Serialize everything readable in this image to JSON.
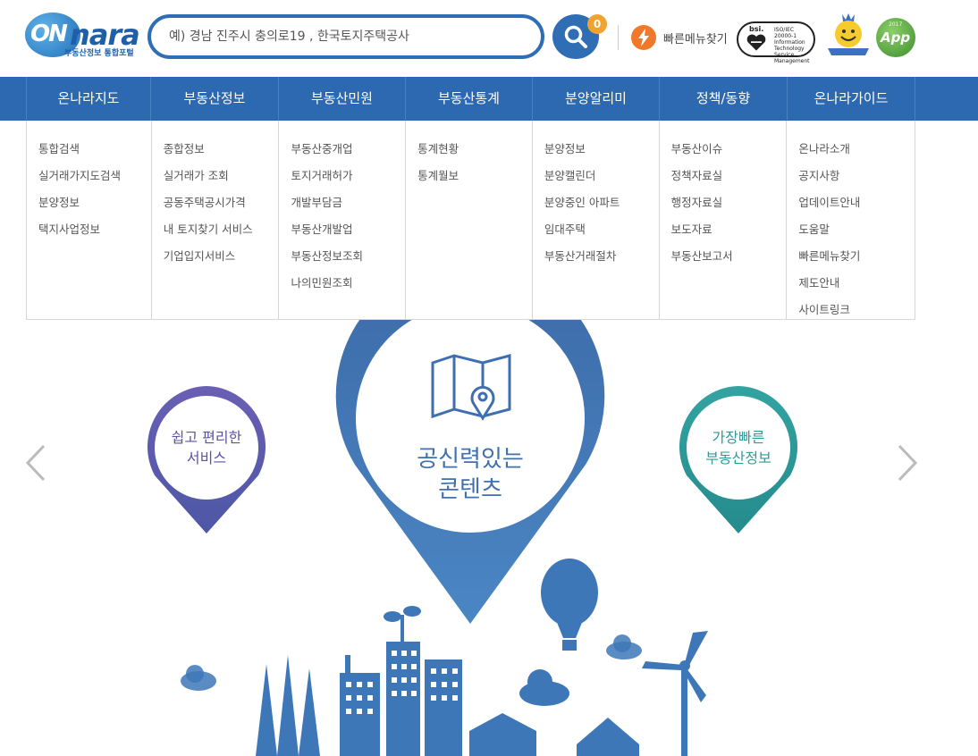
{
  "logo": {
    "on": "ON",
    "nara": "nara",
    "tagline": "부동산정보 통합포털"
  },
  "search": {
    "placeholder": "예) 경남 진주시 충의로19 , 한국토지주택공사",
    "badge_count": "0"
  },
  "quick_menu": {
    "label": "빠른메뉴찾기"
  },
  "certs": {
    "bsi": "bsi.",
    "iso_lines": [
      "ISO/IEC",
      "20000-1",
      "Information",
      "Technology Service",
      "Management"
    ],
    "app": "App",
    "app_year": "2017"
  },
  "nav": {
    "tabs": [
      "온나라지도",
      "부동산정보",
      "부동산민원",
      "부동산통계",
      "분양알리미",
      "정책/동향",
      "온나라가이드"
    ]
  },
  "mega_menu": [
    [
      "통합검색",
      "실거래가지도검색",
      "분양정보",
      "택지사업정보"
    ],
    [
      "종합정보",
      "실거래가 조회",
      "공동주택공시가격",
      "내 토지찾기 서비스",
      "기업입지서비스"
    ],
    [
      "부동산중개업",
      "토지거래허가",
      "개발부담금",
      "부동산개발업",
      "부동산정보조회",
      "나의민원조회"
    ],
    [
      "통계현황",
      "통계월보"
    ],
    [
      "분양정보",
      "분양캘린더",
      "분양중인 아파트",
      "임대주택",
      "부동산거래절차"
    ],
    [
      "부동산이슈",
      "정책자료실",
      "행정자료실",
      "보도자료",
      "부동산보고서"
    ],
    [
      "온나라소개",
      "공지사항",
      "업데이트안내",
      "도움말",
      "빠른메뉴찾기",
      "제도안내",
      "사이트링크"
    ]
  ],
  "hero": {
    "left_pin": [
      "쉽고 편리한",
      "서비스"
    ],
    "center_pin": [
      "공신력있는",
      "콘텐츠"
    ],
    "right_pin": [
      "가장빠른",
      "부동산정보"
    ]
  },
  "colors": {
    "nav_bg": "#2c69b1",
    "left_pin": "#5c53a8",
    "center_pin": "#3f70b0",
    "right_pin": "#2f9a9a",
    "city": "#3e77b8"
  }
}
